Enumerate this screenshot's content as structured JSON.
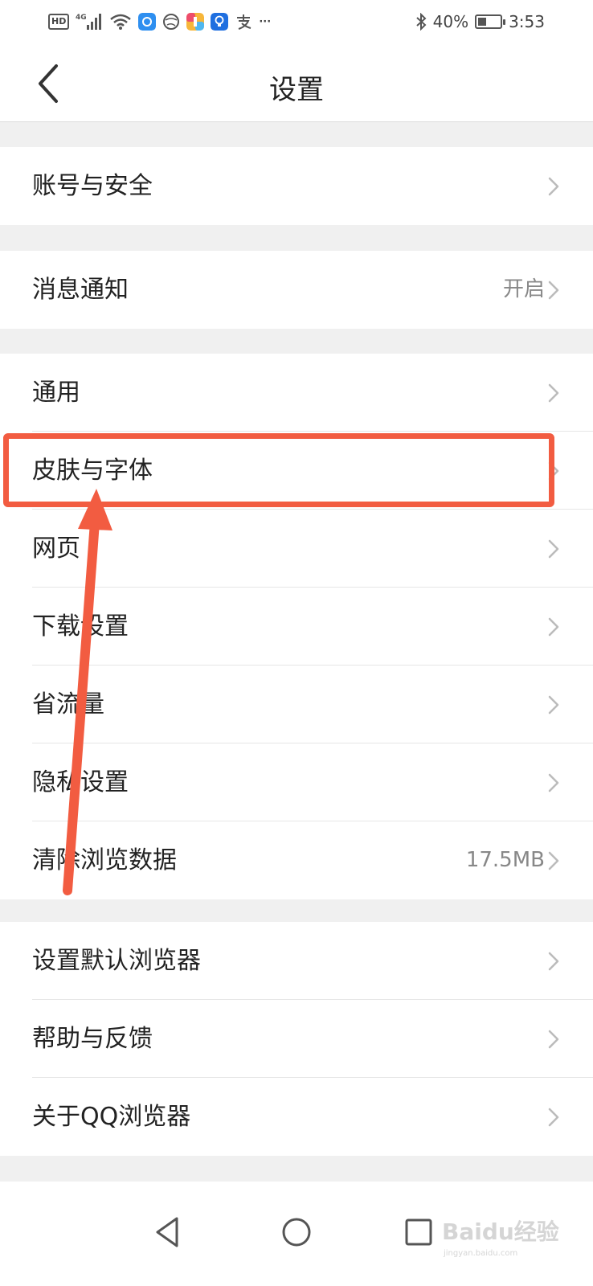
{
  "status_bar": {
    "left_icons": [
      "hd-icon",
      "signal-4g-icon",
      "wifi-icon",
      "app-blue-icon",
      "globe-icon",
      "app-colorful-icon",
      "bulb-icon",
      "alipay-icon",
      "more-dots-icon"
    ],
    "hd_text": "HD",
    "network_text": "4G",
    "more_text": "···",
    "battery_percent": "40%",
    "battery_level": 0.4,
    "time": "3:53"
  },
  "header": {
    "title": "设置"
  },
  "groups": [
    {
      "items": [
        {
          "label": "账号与安全",
          "value": ""
        }
      ]
    },
    {
      "items": [
        {
          "label": "消息通知",
          "value": "开启"
        }
      ]
    },
    {
      "items": [
        {
          "label": "通用",
          "value": ""
        },
        {
          "label": "皮肤与字体",
          "value": ""
        },
        {
          "label": "网页",
          "value": ""
        },
        {
          "label": "下载设置",
          "value": ""
        },
        {
          "label": "省流量",
          "value": ""
        },
        {
          "label": "隐私设置",
          "value": ""
        },
        {
          "label": "清除浏览数据",
          "value": "17.5MB"
        }
      ]
    },
    {
      "items": [
        {
          "label": "设置默认浏览器",
          "value": ""
        },
        {
          "label": "帮助与反馈",
          "value": ""
        },
        {
          "label": "关于QQ浏览器",
          "value": ""
        }
      ]
    }
  ],
  "nav_bar": {
    "buttons": [
      "back-triangle-icon",
      "home-circle-icon",
      "recents-square-icon"
    ]
  },
  "annotation": {
    "highlight_color": "#f25c41",
    "target": "皮肤与字体"
  },
  "watermark": {
    "text": "Baidu经验",
    "subtext": "jingyan.baidu.com"
  },
  "colors": {
    "background_gap": "#f0f0f0",
    "text_primary": "#222222",
    "text_secondary": "#888888",
    "chevron": "#bbbbbb"
  }
}
